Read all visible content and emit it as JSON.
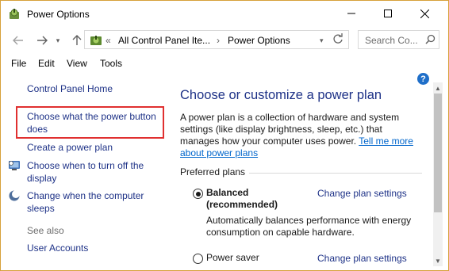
{
  "window": {
    "title": "Power Options",
    "minimize_icon": "minimize-icon",
    "maximize_icon": "maximize-icon",
    "close_icon": "close-icon"
  },
  "address_bar": {
    "crumbs": [
      "«",
      "All Control Panel Ite...",
      "›",
      "Power Options"
    ],
    "search_placeholder": "Search Co...",
    "dropdown_icon": "chevron-down-icon",
    "refresh_icon": "refresh-icon"
  },
  "menu": [
    "File",
    "Edit",
    "View",
    "Tools"
  ],
  "left_pane": {
    "home": "Control Panel Home",
    "power_button": "Choose what the power button does",
    "create_plan": "Create a power plan",
    "turn_off_display": "Choose when to turn off the display",
    "sleep": "Change when the computer sleeps",
    "see_also": "See also",
    "user_accounts": "User Accounts"
  },
  "main": {
    "heading": "Choose or customize a power plan",
    "description": "A power plan is a collection of hardware and system settings (like display brightness, sleep, etc.) that manages how your computer uses power.",
    "learn_more": "Tell me more about power plans",
    "preferred_label": "Preferred plans",
    "plans": [
      {
        "name": "Balanced",
        "tag": "(recommended)",
        "selected": true,
        "description": "Automatically balances performance with energy consumption on capable hardware.",
        "link": "Change plan settings"
      },
      {
        "name": "Power saver",
        "selected": false,
        "link": "Change plan settings"
      }
    ]
  },
  "colors": {
    "link": "#1e3287",
    "highlight_border": "#e03030",
    "window_border": "#d7a13a"
  }
}
